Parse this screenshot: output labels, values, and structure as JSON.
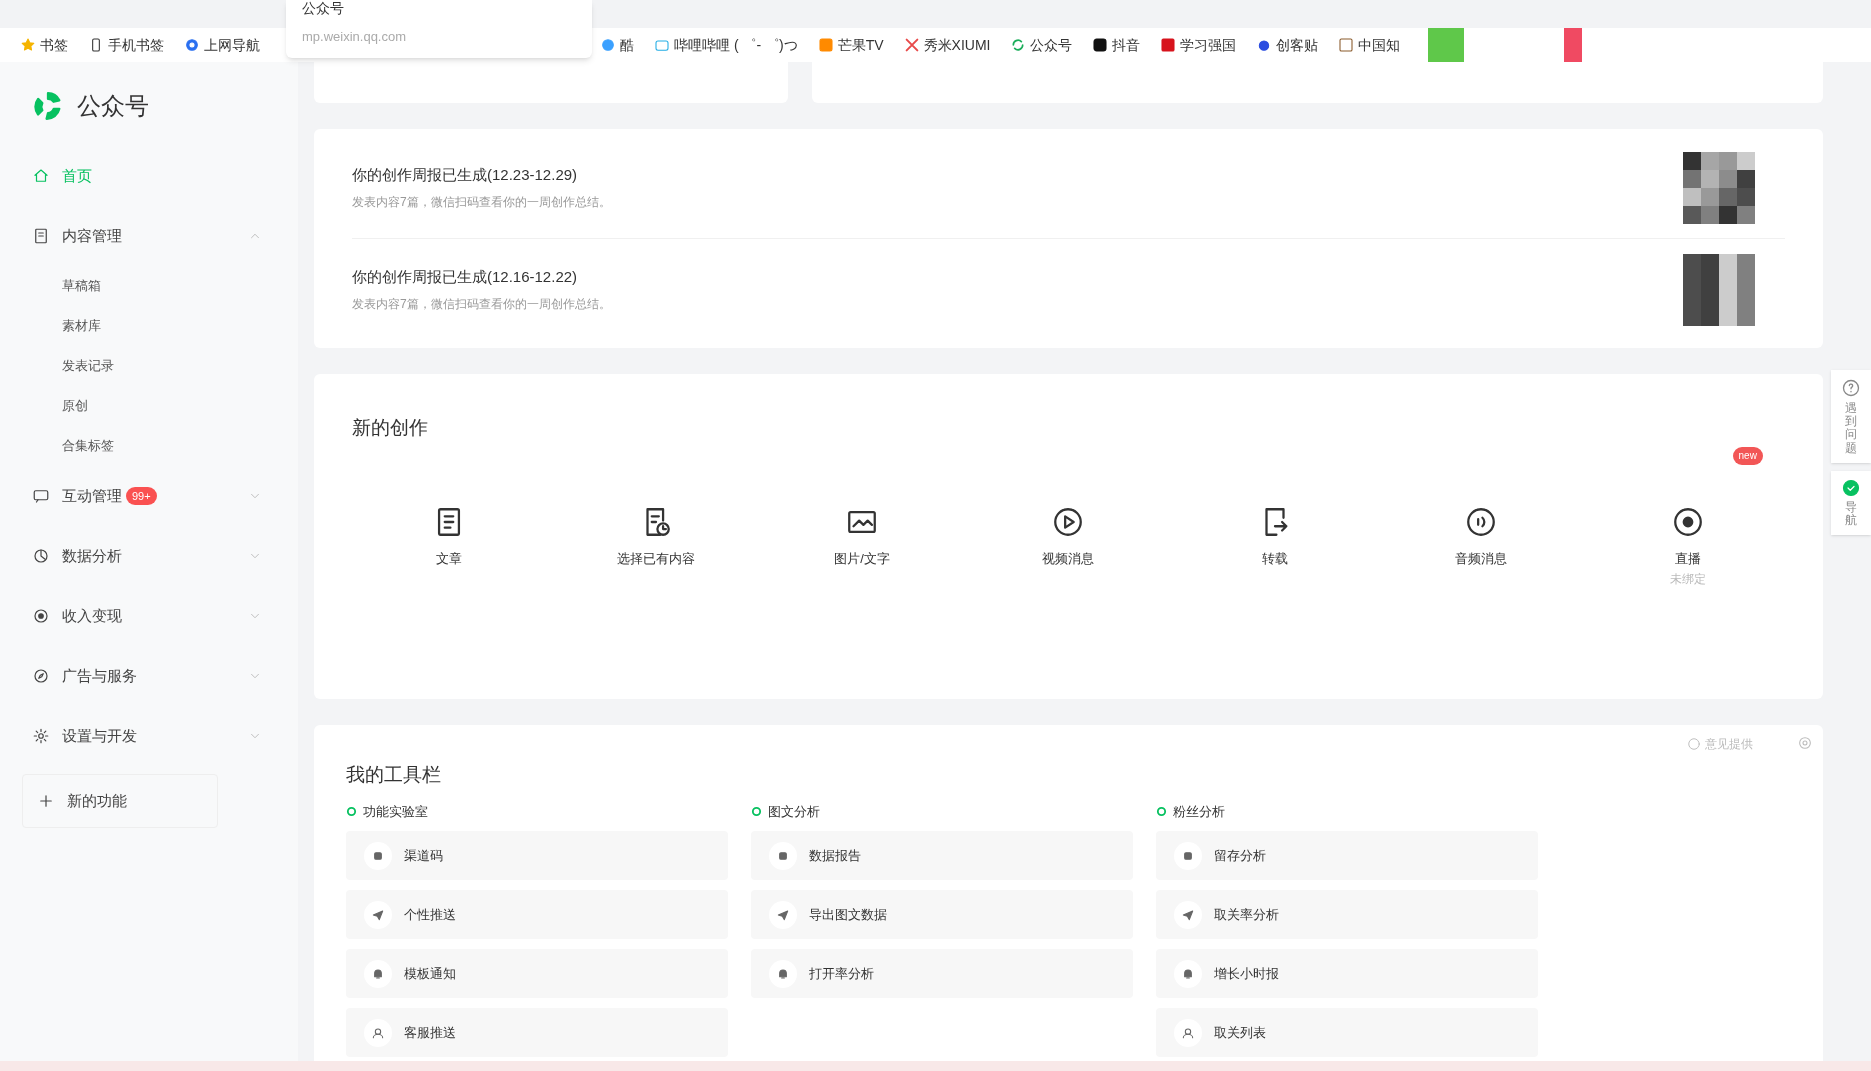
{
  "browser": {
    "bookmarks": [
      {
        "label": "书签"
      },
      {
        "label": "手机书签"
      },
      {
        "label": "上网导航"
      },
      {
        "label": "酷"
      },
      {
        "label": "哔哩哔哩 ( ゜- ゜)つ"
      },
      {
        "label": "芒果TV"
      },
      {
        "label": "秀米XIUMI"
      },
      {
        "label": "公众号"
      },
      {
        "label": "抖音"
      },
      {
        "label": "学习强国"
      },
      {
        "label": "创客贴"
      },
      {
        "label": "中国知"
      }
    ],
    "url_popup": {
      "title": "公众号",
      "url": "mp.weixin.qq.com"
    }
  },
  "sidebar": {
    "logo": "公众号",
    "items": [
      {
        "label": "首页",
        "selected": true,
        "expanded": false
      },
      {
        "label": "内容管理",
        "selected": false,
        "expanded": true,
        "children": [
          {
            "label": "草稿箱"
          },
          {
            "label": "素材库"
          },
          {
            "label": "发表记录"
          },
          {
            "label": "原创"
          },
          {
            "label": "合集标签"
          }
        ]
      },
      {
        "label": "互动管理",
        "selected": false,
        "expanded": false,
        "badge": "99+"
      },
      {
        "label": "数据分析",
        "selected": false,
        "expanded": false
      },
      {
        "label": "收入变现",
        "selected": false,
        "expanded": false
      },
      {
        "label": "广告与服务",
        "selected": false,
        "expanded": false
      },
      {
        "label": "设置与开发",
        "selected": false,
        "expanded": false
      }
    ],
    "new_features": "新的功能"
  },
  "weekly_reports": [
    {
      "title": "你的创作周报已生成(12.23-12.29)",
      "subtitle": "发表内容7篇，微信扫码查看你的一周创作总结。"
    },
    {
      "title": "你的创作周报已生成(12.16-12.22)",
      "subtitle": "发表内容7篇，微信扫码查看你的一周创作总结。"
    }
  ],
  "create": {
    "title": "新的创作",
    "items": [
      {
        "label": "文章"
      },
      {
        "label": "选择已有内容"
      },
      {
        "label": "图片/文字"
      },
      {
        "label": "视频消息"
      },
      {
        "label": "转载"
      },
      {
        "label": "音频消息"
      },
      {
        "label": "直播",
        "note": "未绑定",
        "badge": "new"
      }
    ]
  },
  "toolbar": {
    "title": "我的工具栏",
    "feedback": "意见提供",
    "groups": [
      {
        "title": "功能实验室",
        "items": [
          "渠道码",
          "个性推送",
          "模板通知",
          "客服推送"
        ]
      },
      {
        "title": "图文分析",
        "items": [
          "数据报告",
          "导出图文数据",
          "打开率分析"
        ]
      },
      {
        "title": "粉丝分析",
        "items": [
          "留存分析",
          "取关率分析",
          "增长小时报",
          "取关列表"
        ]
      }
    ]
  },
  "help": {
    "items": [
      "遇到问题",
      "导航"
    ]
  }
}
